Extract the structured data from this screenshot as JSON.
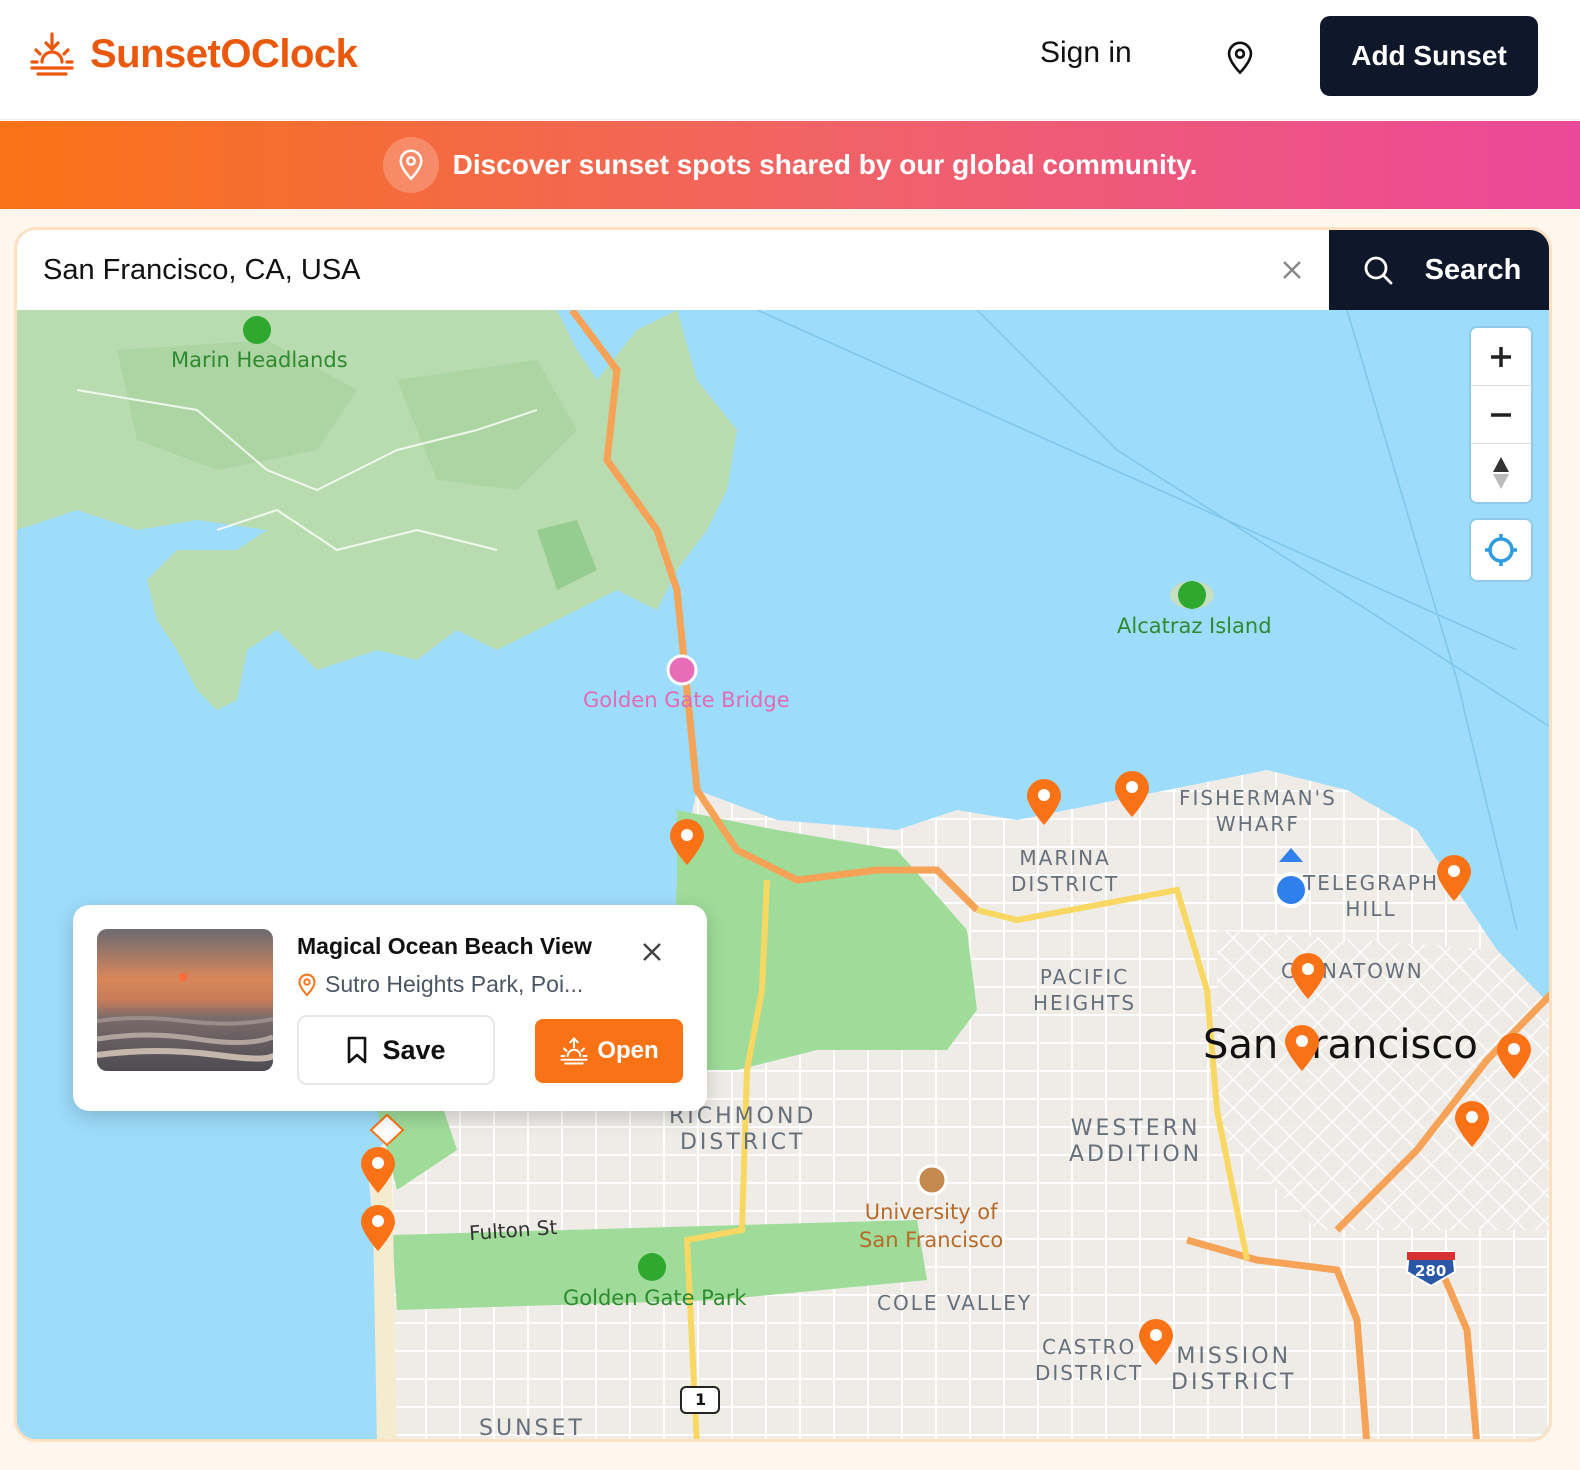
{
  "header": {
    "brand": "SunsetOClock",
    "sign_in": "Sign in",
    "location_icon": "map-pin-icon",
    "add_sunset": "Add Sunset"
  },
  "banner": {
    "icon": "map-pin-icon",
    "text": "Discover sunset spots shared by our global community."
  },
  "search": {
    "value": "San Francisco, CA, USA",
    "button": "Search"
  },
  "map": {
    "labels": {
      "marin_headlands": "Marin Headlands",
      "golden_gate_bridge": "Golden Gate Bridge",
      "alcatraz": "Alcatraz Island",
      "fishermans_wharf": "FISHERMAN'S\nWHARF",
      "marina": "MARINA\nDISTRICT",
      "telegraph": "TELEGRAPH\nHILL",
      "pacific_heights": "PACIFIC\nHEIGHTS",
      "chinatown": "CHINATOWN",
      "city": "San Francisco",
      "western_addition": "WESTERN\nADDITION",
      "richmond": "RICHMOND\nDISTRICT",
      "usf": "University of\nSan Francisco",
      "fulton": "Fulton St",
      "golden_gate_park": "Golden Gate Park",
      "cole_valley": "COLE VALLEY",
      "castro": "CASTRO\nDISTRICT",
      "mission": "MISSION\nDISTRICT",
      "sunset": "SUNSET",
      "hwy_1": "1",
      "hwy_280": "280"
    },
    "accent_color": "#f97316",
    "water_color": "#9ddcfb"
  },
  "popup": {
    "title": "Magical Ocean Beach View",
    "location": "Sutro Heights Park, Poi...",
    "save": "Save",
    "open": "Open"
  }
}
